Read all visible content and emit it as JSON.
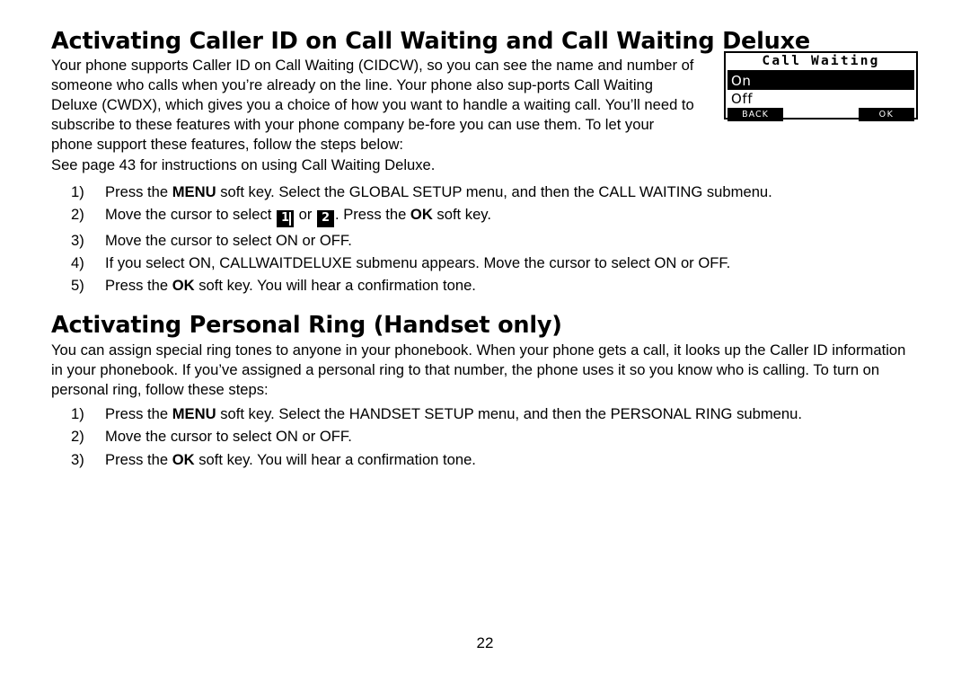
{
  "document": {
    "page_number": "22",
    "sections": [
      {
        "title": "Activating Caller ID on Call Waiting and Call Waiting Deluxe",
        "paragraph_1": "Your phone supports Caller ID on Call Waiting (CIDCW), so you can see the name and number of someone who calls when you’re already on the line. Your phone also sup-ports Call Waiting Deluxe (CWDX), which gives you a choice of how you want to handle a waiting call. You’ll need to subscribe to these features with your phone company be-fore you can use them. To let your phone support these features, follow the steps below:",
        "paragraph_2": "See page 43 for instructions on using Call Waiting Deluxe.",
        "steps": [
          {
            "num": "1)",
            "pre": "Press the ",
            "bold1": "MENU",
            "mid": " soft key. Select the GLOBAL SETUP menu, and then the CALL WAITING submenu.",
            "bold2": "",
            "post": ""
          },
          {
            "num": "2)",
            "pre": "Move the cursor to select ",
            "key1": "1",
            "between": " or ",
            "key2": "2",
            "mid": ". Press the ",
            "bold2": "OK",
            "post": " soft key."
          },
          {
            "num": "3)",
            "pre": "Move the cursor to select ON or OFF.",
            "bold1": "",
            "mid": "",
            "bold2": "",
            "post": ""
          },
          {
            "num": "4)",
            "pre": "If you select ON, CALLWAITDELUXE submenu appears. Move the cursor to select ON or OFF.",
            "bold1": "",
            "mid": "",
            "bold2": "",
            "post": ""
          },
          {
            "num": "5)",
            "pre": "Press the ",
            "bold1": "OK",
            "mid": " soft key. You will hear a confirmation tone.",
            "bold2": "",
            "post": ""
          }
        ]
      },
      {
        "title": "Activating Personal Ring (Handset only)",
        "paragraph_1": "You can assign special ring tones to anyone in your phonebook. When your phone gets a call, it looks up the Caller ID information in your phonebook. If you’ve assigned a personal ring to that number, the phone uses it so you know who is calling. To turn on personal ring, follow these steps:",
        "steps": [
          {
            "num": "1)",
            "pre": "Press the ",
            "bold1": "MENU",
            "mid": " soft key. Select the HANDSET SETUP menu, and then the PERSONAL RING submenu.",
            "bold2": "",
            "post": ""
          },
          {
            "num": "2)",
            "pre": "Move the cursor to select ON or OFF.",
            "bold1": "",
            "mid": "",
            "bold2": "",
            "post": ""
          },
          {
            "num": "3)",
            "pre": "Press the ",
            "bold1": "OK",
            "mid": " soft key. You will hear a confirmation tone.",
            "bold2": "",
            "post": ""
          }
        ]
      }
    ]
  },
  "lcd_illustration": {
    "title": "Call Waiting",
    "option_selected": "On",
    "option_plain": "Off",
    "softkey_left": "BACK",
    "softkey_right": "OK",
    "colors": {
      "border": "#000000",
      "highlight_bg": "#000000",
      "highlight_fg": "#ffffff",
      "background": "#ffffff"
    }
  }
}
